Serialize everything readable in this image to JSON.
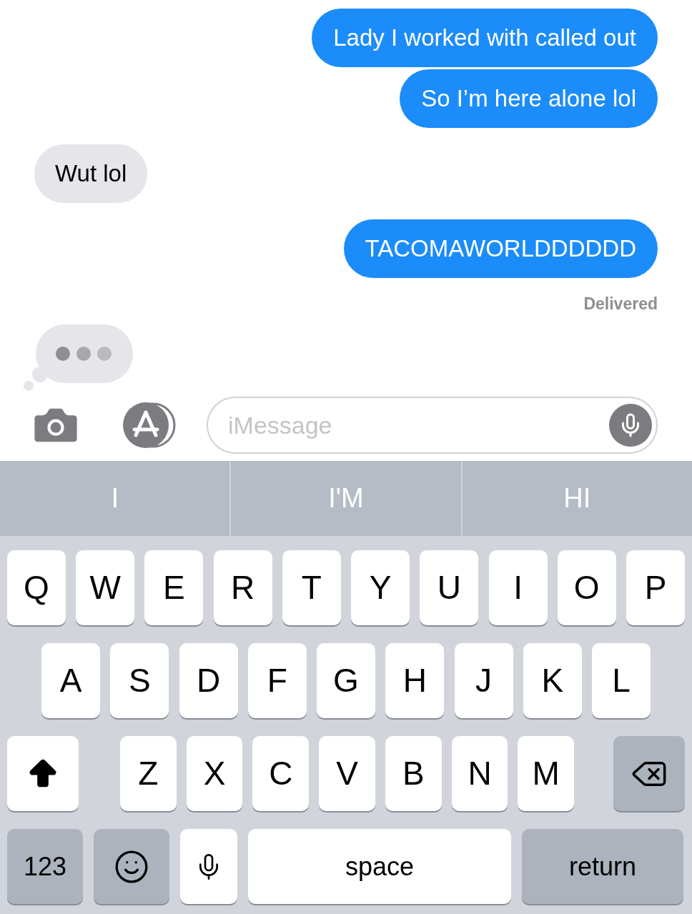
{
  "messages": [
    {
      "kind": "sent",
      "text": "Lady I worked with called out"
    },
    {
      "kind": "sent",
      "text": "So I’m here alone lol"
    },
    {
      "kind": "received",
      "text": "Wut lol"
    },
    {
      "kind": "sent",
      "text": "TACOMAWORLDDDDDD"
    },
    {
      "kind": "status",
      "text": "Delivered"
    },
    {
      "kind": "typing"
    }
  ],
  "composer": {
    "placeholder": "iMessage"
  },
  "suggestions": [
    "I",
    "I'M",
    "HI"
  ],
  "keyboard": [
    [
      {
        "kind": "letter",
        "label": "Q"
      },
      {
        "kind": "letter",
        "label": "W"
      },
      {
        "kind": "letter",
        "label": "E"
      },
      {
        "kind": "letter",
        "label": "R"
      },
      {
        "kind": "letter",
        "label": "T"
      },
      {
        "kind": "letter",
        "label": "Y"
      },
      {
        "kind": "letter",
        "label": "U"
      },
      {
        "kind": "letter",
        "label": "I"
      },
      {
        "kind": "letter",
        "label": "O"
      },
      {
        "kind": "letter",
        "label": "P"
      }
    ],
    [
      {
        "kind": "letter",
        "label": "A"
      },
      {
        "kind": "letter",
        "label": "S"
      },
      {
        "kind": "letter",
        "label": "D"
      },
      {
        "kind": "letter",
        "label": "F"
      },
      {
        "kind": "letter",
        "label": "G"
      },
      {
        "kind": "letter",
        "label": "H"
      },
      {
        "kind": "letter",
        "label": "J"
      },
      {
        "kind": "letter",
        "label": "K"
      },
      {
        "kind": "letter",
        "label": "L"
      }
    ],
    [
      {
        "kind": "shift"
      },
      {
        "kind": "letter",
        "label": "Z"
      },
      {
        "kind": "letter",
        "label": "X"
      },
      {
        "kind": "letter",
        "label": "C"
      },
      {
        "kind": "letter",
        "label": "V"
      },
      {
        "kind": "letter",
        "label": "B"
      },
      {
        "kind": "letter",
        "label": "N"
      },
      {
        "kind": "letter",
        "label": "M"
      },
      {
        "kind": "delete"
      }
    ],
    [
      {
        "kind": "numbers",
        "label": "123"
      },
      {
        "kind": "emoji"
      },
      {
        "kind": "mic"
      },
      {
        "kind": "space",
        "label": "space"
      },
      {
        "kind": "return",
        "label": "return"
      }
    ]
  ]
}
